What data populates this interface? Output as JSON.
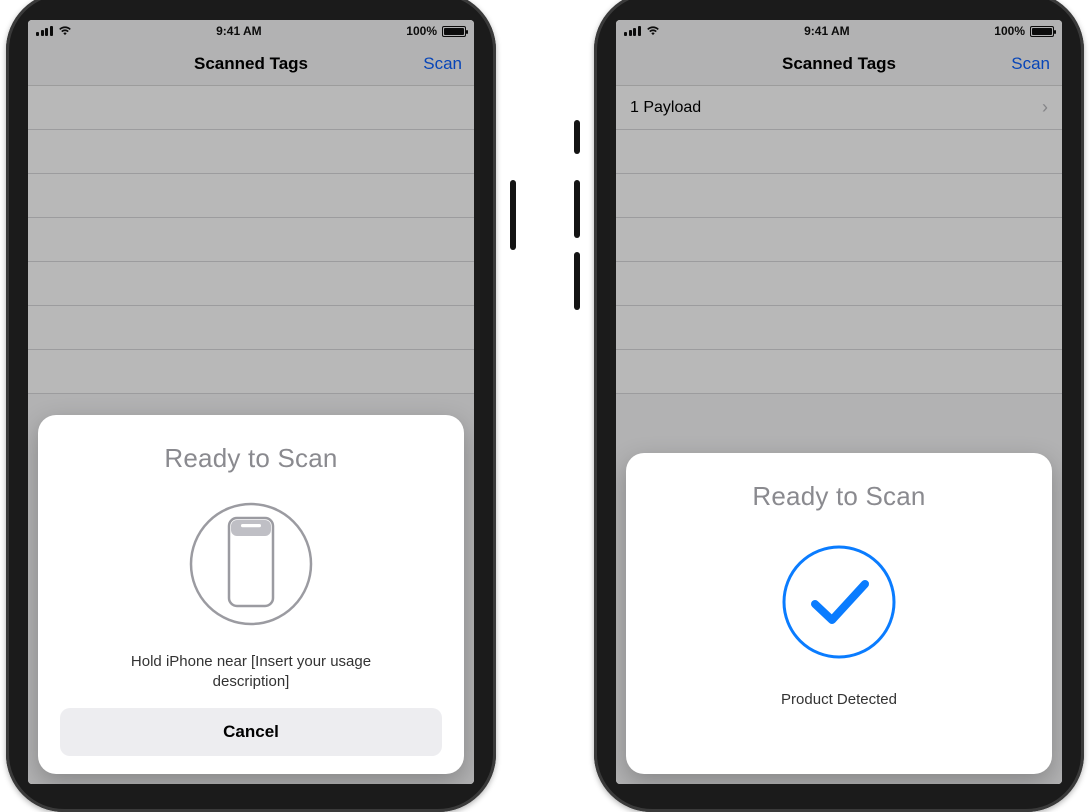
{
  "statusbar": {
    "time": "9:41 AM",
    "battery_text": "100%"
  },
  "navbar": {
    "title": "Scanned Tags",
    "scan": "Scan"
  },
  "list_right": {
    "row1_label": "1 Payload"
  },
  "sheet_left": {
    "title": "Ready to Scan",
    "message": "Hold iPhone near [Insert your usage description]",
    "cancel": "Cancel"
  },
  "sheet_right": {
    "title": "Ready to Scan",
    "message": "Product Detected"
  },
  "colors": {
    "accent_blue": "#0a60ff",
    "check_blue": "#0a7cff"
  }
}
